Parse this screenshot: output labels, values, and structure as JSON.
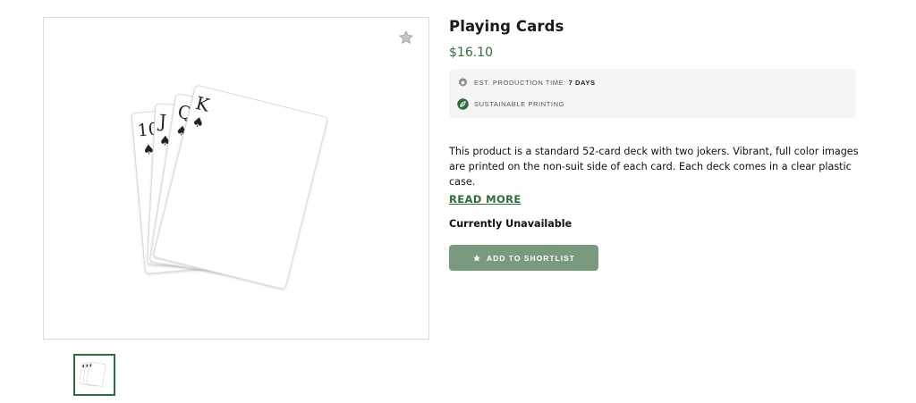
{
  "product": {
    "title": "Playing Cards",
    "price": "$16.10",
    "production_label": "EST. PRODUCTION TIME:",
    "production_value": "7 DAYS",
    "sustainable_label": "SUSTAINABLE PRINTING",
    "description": "This product is a standard 52-card deck with two jokers. Vibrant, full color images are printed on the non-suit side of each card. Each deck comes in a clear plastic case.",
    "read_more": "READ MORE",
    "availability": "Currently Unavailable",
    "shortlist_button": "ADD TO SHORTLIST"
  },
  "gallery": {
    "card_ranks": [
      "10",
      "J",
      "Q",
      "K"
    ],
    "suit": "♠",
    "thumbnail_count": 1
  },
  "icons": {
    "favorite": "star-icon",
    "production": "gear-icon",
    "sustainable": "leaf-icon",
    "shortlist": "star-icon"
  },
  "colors": {
    "accent_green": "#2f6b3b",
    "button_green": "#7a9a7f",
    "info_box_bg": "#f5f5f5"
  }
}
